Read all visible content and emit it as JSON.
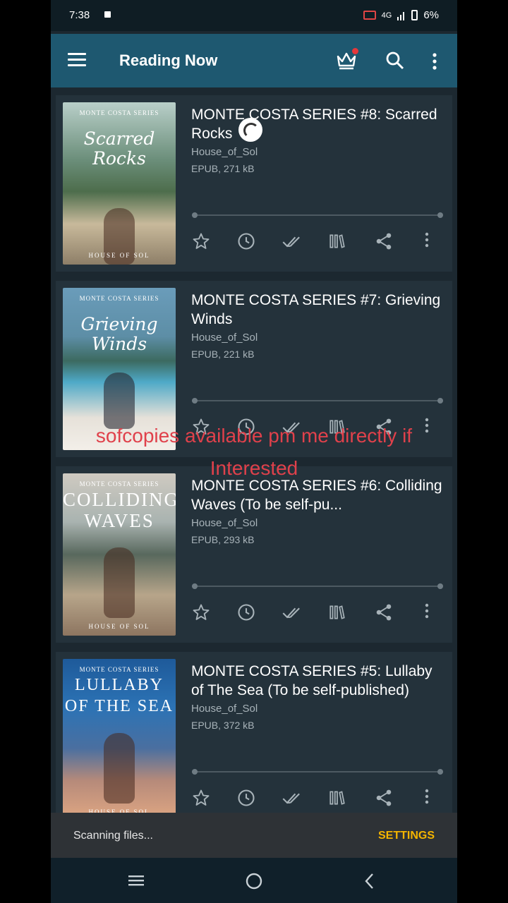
{
  "status": {
    "time": "7:38",
    "network": "4G",
    "battery": "6%"
  },
  "appbar": {
    "title": "Reading Now",
    "icons": [
      "menu-icon",
      "crown-icon",
      "search-icon",
      "more-vert-icon"
    ]
  },
  "books": [
    {
      "title": "MONTE COSTA SERIES #8: Scarred Rocks",
      "author": "House_of_Sol",
      "meta": "EPUB, 271 kB",
      "cover": {
        "series": "MONTE COSTA SERIES",
        "title": "Scarred Rocks",
        "publisher": "HOUSE OF SOL"
      }
    },
    {
      "title": "MONTE COSTA SERIES #7: Grieving Winds",
      "author": "House_of_Sol",
      "meta": "EPUB, 221 kB",
      "cover": {
        "series": "MONTE COSTA SERIES",
        "title": "Grieving Winds",
        "publisher": ""
      }
    },
    {
      "title": "MONTE COSTA SERIES #6: Colliding Waves (To be self-pu...",
      "author": "House_of_Sol",
      "meta": "EPUB, 293 kB",
      "cover": {
        "series": "MONTE COSTA SERIES",
        "title": "COLLIDING WAVES",
        "publisher": "HOUSE OF SOL"
      }
    },
    {
      "title": "MONTE COSTA SERIES #5: Lullaby of The Sea (To be self-published)",
      "author": "House_of_Sol",
      "meta": "EPUB, 372 kB",
      "cover": {
        "series": "MONTE COSTA SERIES",
        "title": "LULLABY OF THE SEA",
        "publisher": "HOUSE OF SOL"
      }
    }
  ],
  "overlay": {
    "line1": "sofcopies available pm me directly if",
    "line2": "Interested"
  },
  "snackbar": {
    "message": "Scanning files...",
    "action": "SETTINGS"
  },
  "colors": {
    "appbar": "#1e5870",
    "background": "#1c2830",
    "card": "#24323b",
    "overlay_text": "#e0414b",
    "snackbar_action": "#f4b400"
  }
}
